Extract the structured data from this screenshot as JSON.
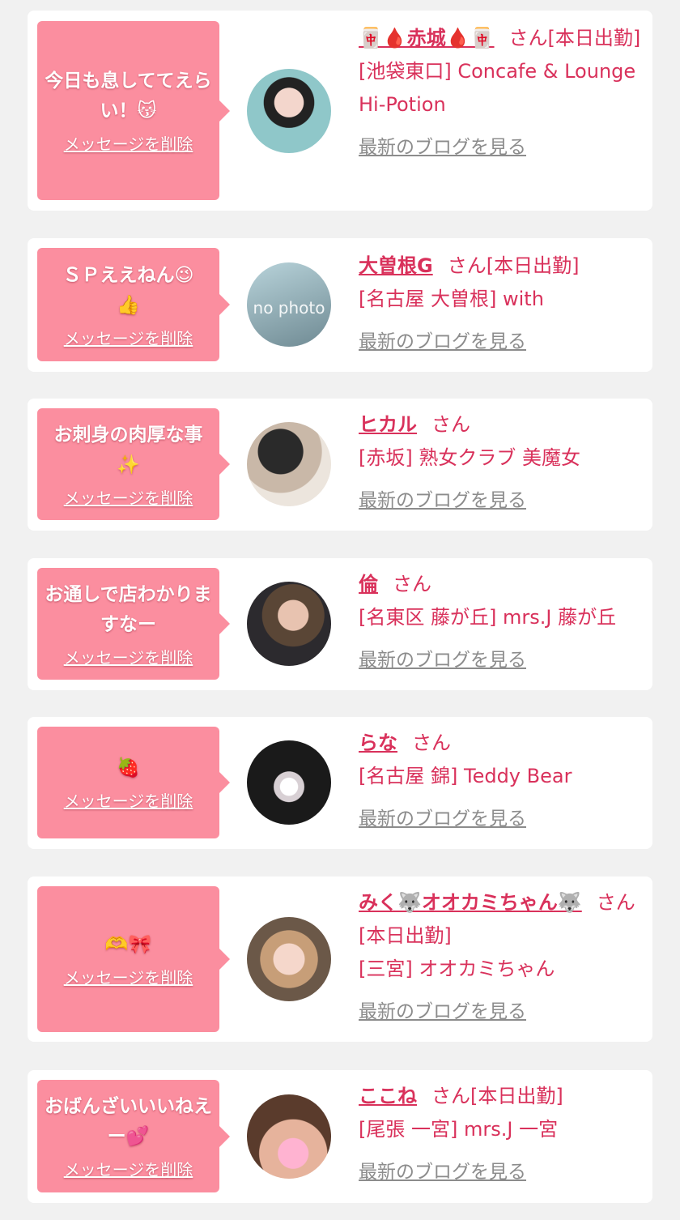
{
  "delete_label": "メッセージを削除",
  "blog_label": "最新のブログを見る",
  "san_suffix": "さん",
  "colors": {
    "bubble": "#fb8e9f",
    "accent": "#d9315b",
    "muted": "#8c8c8c",
    "background": "#f1f1f1"
  },
  "cards": [
    {
      "message": "今日も息しててえらい！😽",
      "name": "🀄🩸赤城🩸🀄",
      "status": "[本日出勤]",
      "shop": "[池袋東口] Concafe & Lounge Hi-Potion"
    },
    {
      "message": "ＳＰええねん😉\n👍",
      "name": "大曽根G",
      "status": "[本日出勤]",
      "shop": "[名古屋 大曽根] with",
      "photo_text": "no photo"
    },
    {
      "message": "お刺身の肉厚な事\n✨",
      "name": "ヒカル",
      "status": "",
      "shop": "[赤坂] 熟女クラブ 美魔女"
    },
    {
      "message": "お通しで店わかりますなー",
      "name": "倫",
      "status": "",
      "shop": "[名東区 藤が丘] mrs.J 藤が丘"
    },
    {
      "message": "🍓",
      "name": "らな",
      "status": "",
      "shop": "[名古屋 錦] Teddy Bear"
    },
    {
      "message": "🫶🎀",
      "name": "みく🐺オオカミちゃん🐺",
      "status": "[本日出勤]",
      "shop": "[三宮] オオカミちゃん"
    },
    {
      "message": "おばんざいいいねえー💕",
      "name": "ここね",
      "status": "[本日出勤]",
      "shop": "[尾張 一宮] mrs.J 一宮"
    }
  ]
}
